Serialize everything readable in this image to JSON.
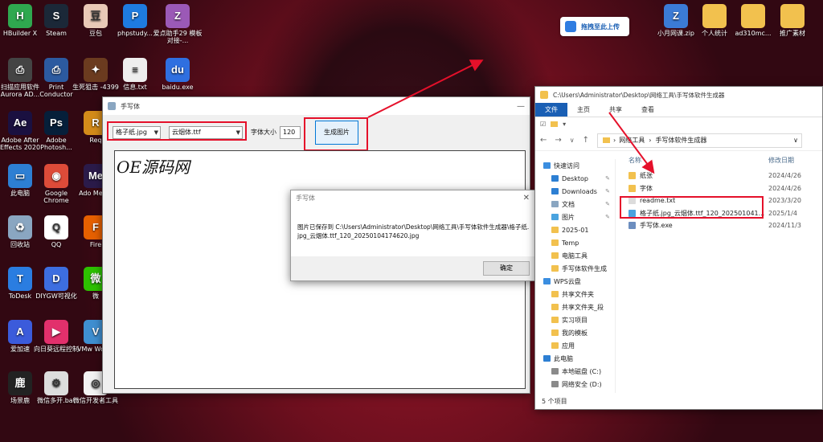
{
  "desktop": {
    "left_icons": [
      {
        "label": "HBuilder X",
        "icon": "hbuilder-icon",
        "color": "#2fa84f",
        "glyph": "H"
      },
      {
        "label": "Steam",
        "icon": "steam-icon",
        "color": "#1b2838",
        "glyph": "S"
      },
      {
        "label": "豆包",
        "icon": "doubao-icon",
        "color": "#e9c9b7",
        "glyph": "豆"
      },
      {
        "label": "phpstudy...",
        "icon": "phpstudy-icon",
        "color": "#1e7be0",
        "glyph": "P"
      },
      {
        "label": "爱点助手29 模板对接-...",
        "icon": "archive-icon",
        "color": "#9b59b6",
        "glyph": "Z"
      },
      {
        "label": "扫描应用软件 Aurora AD...",
        "icon": "scanner-icon",
        "color": "#444",
        "glyph": "⎙"
      },
      {
        "label": "Print Conductor",
        "icon": "printer-icon",
        "color": "#2c5aa0",
        "glyph": "⎙"
      },
      {
        "label": "生死狙击 -4399",
        "icon": "game-icon",
        "color": "#6b3b1f",
        "glyph": "✦"
      },
      {
        "label": "信息.txt",
        "icon": "text-file-icon",
        "color": "#eeeeee",
        "glyph": "≡"
      },
      {
        "label": "baidu.exe",
        "icon": "baidu-icon",
        "color": "#2f6fe0",
        "glyph": "du"
      },
      {
        "label": "Adobe After Effects 2020",
        "icon": "after-effects-icon",
        "color": "#1a1040",
        "glyph": "Ae"
      },
      {
        "label": "Adobe Photosh...",
        "icon": "photoshop-icon",
        "color": "#061f3a",
        "glyph": "Ps"
      },
      {
        "label": "Req",
        "icon": "app-icon",
        "color": "#d48b1a",
        "glyph": "R"
      },
      {
        "label": "此电脑",
        "icon": "computer-icon",
        "color": "#2d7fd3",
        "glyph": "▭"
      },
      {
        "label": "Google Chrome",
        "icon": "chrome-icon",
        "color": "#dd4b39",
        "glyph": "◉"
      },
      {
        "label": "Ado Media",
        "icon": "media-encoder-icon",
        "color": "#2b1b4a",
        "glyph": "Me"
      },
      {
        "label": "回收站",
        "icon": "recycle-bin-icon",
        "color": "#8aa6c1",
        "glyph": "♻"
      },
      {
        "label": "QQ",
        "icon": "qq-icon",
        "color": "#ffffff",
        "glyph": "Q"
      },
      {
        "label": "Fire",
        "icon": "firefox-icon",
        "color": "#e66000",
        "glyph": "F"
      },
      {
        "label": "ToDesk",
        "icon": "todesk-icon",
        "color": "#2a7de1",
        "glyph": "T"
      },
      {
        "label": "DIYGW可视化",
        "icon": "diygw-icon",
        "color": "#3d6ee0",
        "glyph": "D"
      },
      {
        "label": "微",
        "icon": "wechat-icon",
        "color": "#2dc100",
        "glyph": "微"
      },
      {
        "label": "爱加速",
        "icon": "aijiasu-icon",
        "color": "#3b5bdb",
        "glyph": "A"
      },
      {
        "label": "向日葵远程控制",
        "icon": "sunflower-icon",
        "color": "#e2306c",
        "glyph": "▶"
      },
      {
        "label": "VMw Works",
        "icon": "vmware-icon",
        "color": "#3f8fd1",
        "glyph": "V"
      },
      {
        "label": "场景鹿",
        "icon": "deer-icon",
        "color": "#222",
        "glyph": "鹿"
      },
      {
        "label": "微信多开.bat",
        "icon": "bat-file-icon",
        "color": "#dddddd",
        "glyph": "⚙"
      },
      {
        "label": "微信开发者工具",
        "icon": "wechat-dev-icon",
        "color": "#f3f3f3",
        "glyph": "◎"
      }
    ],
    "right_icons": [
      {
        "label": "小月网课.zip",
        "icon": "zip-icon",
        "color": "#3b7bd6",
        "glyph": "Z"
      },
      {
        "label": "个人统计",
        "icon": "folder-icon",
        "color": "#f2c14e",
        "glyph": ""
      },
      {
        "label": "ad310mc...",
        "icon": "folder-icon",
        "color": "#f2c14e",
        "glyph": ""
      },
      {
        "label": "推广素材",
        "icon": "folder-icon",
        "color": "#f2c14e",
        "glyph": ""
      }
    ],
    "upload_widget": {
      "label": "拖拽至此上传",
      "icon": "baidu-netdisk-icon"
    }
  },
  "app_window": {
    "title": "手写体",
    "paper_select": "格子纸.jpg",
    "font_select": "云烟体.ttf",
    "font_size_label": "字体大小",
    "font_size_value": "120",
    "generate_button": "生成图片",
    "preview_text": "OE源码网"
  },
  "dialog": {
    "title": "手写体",
    "message": "图片已保存到 C:\\Users\\Administrator\\Desktop\\网络工具\\手写体软件生成器\\格子纸.jpg_云烟体.ttf_120_20250104174620.jpg",
    "ok_button": "确定"
  },
  "explorer": {
    "title_path": "C:\\Users\\Administrator\\Desktop\\网络工具\\手写体软件生成器",
    "ribbon_tabs": [
      "文件",
      "主页",
      "共享",
      "查看"
    ],
    "breadcrumb": [
      "网络工具",
      "手写体软件生成器"
    ],
    "nav_items": [
      {
        "label": "快速访问",
        "section": true,
        "pinned": false,
        "color": "#3b8ee0"
      },
      {
        "label": "Desktop",
        "section": false,
        "pinned": true,
        "color": "#2d7fd3"
      },
      {
        "label": "Downloads",
        "section": false,
        "pinned": true,
        "color": "#2d7fd3"
      },
      {
        "label": "文档",
        "section": false,
        "pinned": true,
        "color": "#8aa6c1"
      },
      {
        "label": "图片",
        "section": false,
        "pinned": true,
        "color": "#4aa3df"
      },
      {
        "label": "2025-01",
        "section": false,
        "pinned": false,
        "color": "#f2c14e"
      },
      {
        "label": "Temp",
        "section": false,
        "pinned": false,
        "color": "#f2c14e"
      },
      {
        "label": "电脑工具",
        "section": false,
        "pinned": false,
        "color": "#f2c14e"
      },
      {
        "label": "手写体软件生成",
        "section": false,
        "pinned": false,
        "color": "#f2c14e"
      },
      {
        "label": "WPS云盘",
        "section": true,
        "pinned": false,
        "color": "#3b8ee0"
      },
      {
        "label": "共享文件夹",
        "section": false,
        "pinned": false,
        "color": "#f2c14e"
      },
      {
        "label": "共享文件夹_段",
        "section": false,
        "pinned": false,
        "color": "#f2c14e"
      },
      {
        "label": "实习项目",
        "section": false,
        "pinned": false,
        "color": "#f2c14e"
      },
      {
        "label": "我的模板",
        "section": false,
        "pinned": false,
        "color": "#f2c14e"
      },
      {
        "label": "应用",
        "section": false,
        "pinned": false,
        "color": "#f2c14e"
      },
      {
        "label": "此电脑",
        "section": true,
        "pinned": false,
        "color": "#2d7fd3"
      },
      {
        "label": "本地磁盘 (C:)",
        "section": false,
        "pinned": false,
        "color": "#8a8a8a"
      },
      {
        "label": "网络安全 (D:)",
        "section": false,
        "pinned": false,
        "color": "#8a8a8a"
      }
    ],
    "column_headers": {
      "name": "名称",
      "date": "修改日期"
    },
    "files": [
      {
        "name": "纸张",
        "date": "2024/4/26",
        "type": "folder"
      },
      {
        "name": "字体",
        "date": "2024/4/26",
        "type": "folder"
      },
      {
        "name": "readme.txt",
        "date": "2023/3/20",
        "type": "text"
      },
      {
        "name": "格子纸.jpg_云烟体.ttf_120_202501041...",
        "date": "2025/1/4",
        "type": "image"
      },
      {
        "name": "手写体.exe",
        "date": "2024/11/3",
        "type": "exe"
      }
    ],
    "status": "5 个项目"
  },
  "colors": {
    "highlight_red": "#e5102a",
    "accent_blue": "#1a5fb4"
  }
}
